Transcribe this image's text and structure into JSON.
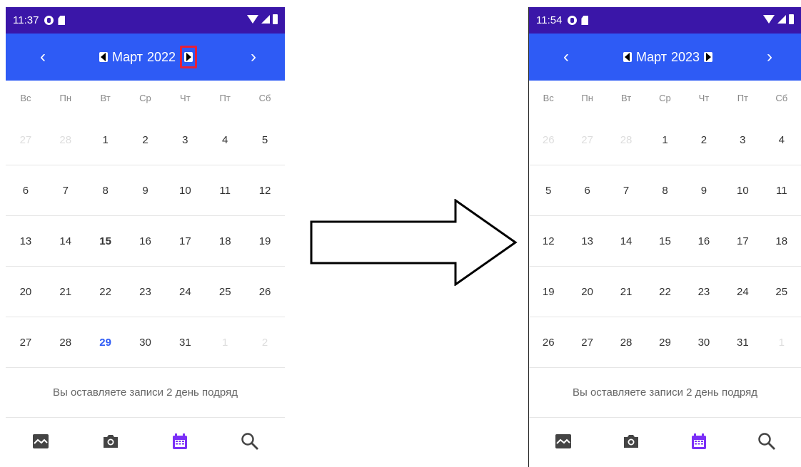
{
  "colors": {
    "status_bar": "#3a16a8",
    "toolbar": "#2e5bf5",
    "today": "#2e5bf5",
    "highlight": "#e5203a",
    "nav_selected": "#7b2ff7"
  },
  "left_screen": {
    "status": {
      "time": "11:37"
    },
    "header": {
      "prev": "‹",
      "month": "Март",
      "year": "2022",
      "next": "›"
    },
    "weekdays": [
      "Вс",
      "Пн",
      "Вт",
      "Ср",
      "Чт",
      "Пт",
      "Сб"
    ],
    "weeks": [
      [
        "27",
        "28",
        "1",
        "2",
        "3",
        "4",
        "5"
      ],
      [
        "6",
        "7",
        "8",
        "9",
        "10",
        "11",
        "12"
      ],
      [
        "13",
        "14",
        "15",
        "16",
        "17",
        "18",
        "19"
      ],
      [
        "20",
        "21",
        "22",
        "23",
        "24",
        "25",
        "26"
      ],
      [
        "27",
        "28",
        "29",
        "30",
        "31",
        "1",
        "2"
      ]
    ],
    "streak": "Вы оставляете записи 2 день подряд"
  },
  "right_screen": {
    "status": {
      "time": "11:54"
    },
    "header": {
      "prev": "‹",
      "month": "Март",
      "year": "2023",
      "next": "›"
    },
    "weekdays": [
      "Вс",
      "Пн",
      "Вт",
      "Ср",
      "Чт",
      "Пт",
      "Сб"
    ],
    "weeks": [
      [
        "26",
        "27",
        "28",
        "1",
        "2",
        "3",
        "4"
      ],
      [
        "5",
        "6",
        "7",
        "8",
        "9",
        "10",
        "11"
      ],
      [
        "12",
        "13",
        "14",
        "15",
        "16",
        "17",
        "18"
      ],
      [
        "19",
        "20",
        "21",
        "22",
        "23",
        "24",
        "25"
      ],
      [
        "26",
        "27",
        "28",
        "29",
        "30",
        "31",
        "1"
      ]
    ],
    "streak": "Вы оставляете записи 2 день подряд"
  },
  "bottom_nav": [
    "gallery-icon",
    "camera-icon",
    "calendar-icon",
    "search-icon"
  ]
}
